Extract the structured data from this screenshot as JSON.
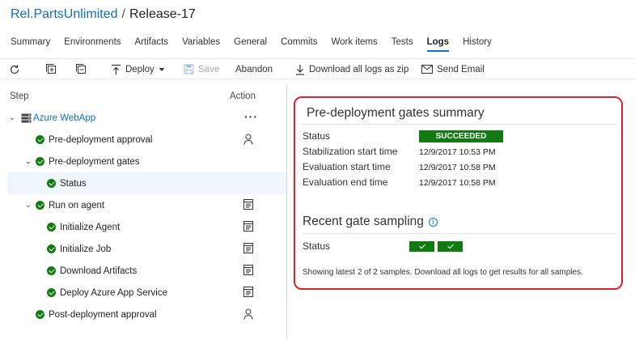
{
  "breadcrumb": {
    "project": "Rel.PartsUnlimited",
    "separator": "/",
    "release": "Release-17"
  },
  "tabs": [
    "Summary",
    "Environments",
    "Artifacts",
    "Variables",
    "General",
    "Commits",
    "Work items",
    "Tests",
    "Logs",
    "History"
  ],
  "active_tab": "Logs",
  "toolbar": {
    "refresh_icon": "refresh-icon",
    "expand_icon": "expand-all-icon",
    "collapse_icon": "collapse-all-icon",
    "deploy": "Deploy",
    "save": "Save",
    "abandon": "Abandon",
    "download": "Download all logs as zip",
    "email": "Send Email"
  },
  "steps_pane": {
    "col_step": "Step",
    "col_action": "Action",
    "environment": "Azure WebApp",
    "items": [
      {
        "label": "Pre-deployment approval",
        "action_icon": "person-icon"
      },
      {
        "label": "Pre-deployment gates",
        "action_icon": ""
      },
      {
        "label": "Status",
        "action_icon": ""
      },
      {
        "label": "Run on agent",
        "action_icon": "log-icon"
      },
      {
        "label": "Initialize Agent",
        "action_icon": "log-icon"
      },
      {
        "label": "Initialize Job",
        "action_icon": "log-icon"
      },
      {
        "label": "Download Artifacts",
        "action_icon": "log-icon"
      },
      {
        "label": "Deploy Azure App Service",
        "action_icon": "log-icon"
      },
      {
        "label": "Post-deployment approval",
        "action_icon": "person-icon"
      }
    ]
  },
  "gates_summary": {
    "title": "Pre-deployment gates summary",
    "rows": [
      {
        "label": "Status",
        "value": "SUCCEEDED"
      },
      {
        "label": "Stabilization start time",
        "value": "12/9/2017 10:53 PM"
      },
      {
        "label": "Evaluation start time",
        "value": "12/9/2017 10:58 PM"
      },
      {
        "label": "Evaluation end time",
        "value": "12/9/2017 10:58 PM"
      }
    ],
    "sampling_title": "Recent gate sampling",
    "sampling_status_label": "Status",
    "sample_count": 2,
    "note": "Showing latest 2 of 2 samples. Download all logs to get results for all samples."
  },
  "colors": {
    "success": "#107c10",
    "link": "#106ebe",
    "highlight": "#d9232e"
  }
}
